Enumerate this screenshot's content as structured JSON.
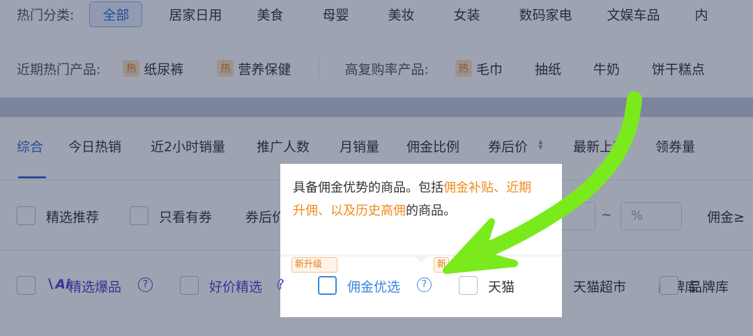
{
  "categories": {
    "label": "热门分类:",
    "items": [
      "全部",
      "居家日用",
      "美食",
      "母婴",
      "美妆",
      "女装",
      "数码家电",
      "文娱车品"
    ],
    "partial": "内"
  },
  "hot_products": {
    "label": "近期热门产品:",
    "hot_badge": "热",
    "items": [
      "纸尿裤",
      "营养保健"
    ]
  },
  "repurchase": {
    "label": "高复购率产品:",
    "hot_item": "毛巾",
    "items": [
      "抽纸",
      "牛奶",
      "饼干糕点"
    ]
  },
  "sort_tabs": [
    "综合",
    "今日热销",
    "近2小时销量",
    "推广人数",
    "月销量",
    "佣金比例",
    "券后价",
    "最新上架",
    "领券量"
  ],
  "sort_arrows": "▴▾",
  "filters": {
    "selected": "精选推荐",
    "coupon_only": "只看有券",
    "after_coupon_price": "券后价",
    "range_sep": "~",
    "percent_placeholder": "%",
    "commission_min": "佣金≥"
  },
  "picks": {
    "ai_mark": "∖Ai",
    "hot_picks": "精选爆品",
    "good_price": "好价精选",
    "commission_pick": "佣金优选",
    "tmall": "天猫",
    "tmall_market": "天猫超市",
    "brand_lib": "品牌库",
    "new_tag": "新升级",
    "new_tag_short": "新",
    "help": "?"
  },
  "tooltip": {
    "pre": "具备佣金优势的商品。包括",
    "highlight": "佣金补贴、近期升佣、以及历史高佣",
    "post": "的商品。"
  },
  "colors": {
    "accent": "#2f6bd8",
    "purple": "#4a3fd0",
    "orange": "#f08a1d",
    "annotation_arrow": "#7bea1c"
  }
}
